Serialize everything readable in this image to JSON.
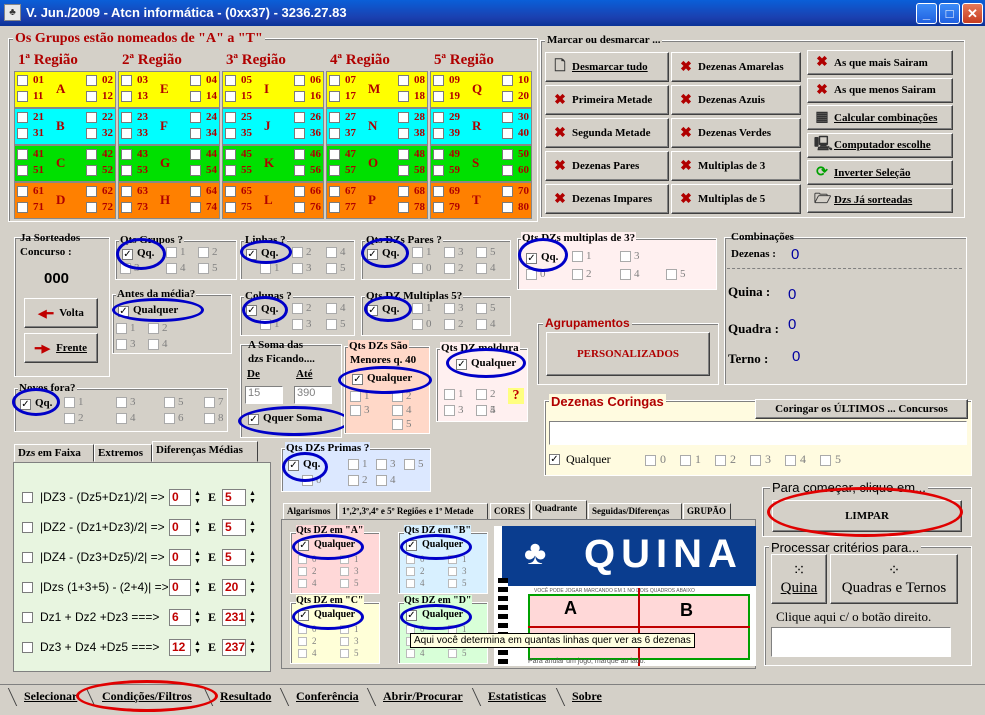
{
  "window": {
    "title": "V. Jun./2009 - Atcn informática - (0xx37) - 3236.27.83",
    "minimize": "_",
    "maximize": "□",
    "close": "✕"
  },
  "groups_title": "Os Grupos estão nomeados de \"A\" a  \"T\"",
  "regions": [
    {
      "title": "1ª Região",
      "rows": [
        {
          "color": "#ffff00",
          "letter": "A",
          "nums": [
            "01",
            "02",
            "11",
            "12"
          ]
        },
        {
          "color": "#00ffff",
          "letter": "B",
          "nums": [
            "21",
            "22",
            "31",
            "32"
          ]
        },
        {
          "color": "#00e000",
          "letter": "C",
          "nums": [
            "41",
            "42",
            "51",
            "52"
          ]
        },
        {
          "color": "#ff8000",
          "letter": "D",
          "nums": [
            "61",
            "62",
            "71",
            "72"
          ]
        }
      ]
    },
    {
      "title": "2ª Região",
      "rows": [
        {
          "color": "#ffff00",
          "letter": "E",
          "nums": [
            "03",
            "04",
            "13",
            "14"
          ]
        },
        {
          "color": "#00ffff",
          "letter": "F",
          "nums": [
            "23",
            "24",
            "33",
            "34"
          ]
        },
        {
          "color": "#00e000",
          "letter": "G",
          "nums": [
            "43",
            "44",
            "53",
            "54"
          ]
        },
        {
          "color": "#ff8000",
          "letter": "H",
          "nums": [
            "63",
            "64",
            "73",
            "74"
          ]
        }
      ]
    },
    {
      "title": "3ª Região",
      "rows": [
        {
          "color": "#ffff00",
          "letter": "I",
          "nums": [
            "05",
            "06",
            "15",
            "16"
          ]
        },
        {
          "color": "#00ffff",
          "letter": "J",
          "nums": [
            "25",
            "26",
            "35",
            "36"
          ]
        },
        {
          "color": "#00e000",
          "letter": "K",
          "nums": [
            "45",
            "46",
            "55",
            "56"
          ]
        },
        {
          "color": "#ff8000",
          "letter": "L",
          "nums": [
            "65",
            "66",
            "75",
            "76"
          ]
        }
      ]
    },
    {
      "title": "4ª Região",
      "rows": [
        {
          "color": "#ffff00",
          "letter": "M",
          "nums": [
            "07",
            "08",
            "17",
            "18"
          ]
        },
        {
          "color": "#00ffff",
          "letter": "N",
          "nums": [
            "27",
            "28",
            "37",
            "38"
          ]
        },
        {
          "color": "#00e000",
          "letter": "O",
          "nums": [
            "47",
            "48",
            "57",
            "58"
          ]
        },
        {
          "color": "#ff8000",
          "letter": "P",
          "nums": [
            "67",
            "68",
            "77",
            "78"
          ]
        }
      ]
    },
    {
      "title": "5ª Região",
      "rows": [
        {
          "color": "#ffff00",
          "letter": "Q",
          "nums": [
            "09",
            "10",
            "19",
            "20"
          ]
        },
        {
          "color": "#00ffff",
          "letter": "R",
          "nums": [
            "29",
            "30",
            "39",
            "40"
          ]
        },
        {
          "color": "#00e000",
          "letter": "S",
          "nums": [
            "49",
            "50",
            "59",
            "60"
          ]
        },
        {
          "color": "#ff8000",
          "letter": "T",
          "nums": [
            "69",
            "70",
            "79",
            "80"
          ]
        }
      ]
    }
  ],
  "marcar": {
    "title": "Marcar  ou desmarcar ...",
    "col1": [
      {
        "icon": "doc-icon",
        "label": "Desmarcar tudo"
      },
      {
        "icon": "x-icon",
        "label": "Primeira Metade"
      },
      {
        "icon": "x-icon",
        "label": "Segunda Metade"
      },
      {
        "icon": "x-icon",
        "label": "Dezenas Pares"
      },
      {
        "icon": "x-icon",
        "label": "Dezenas Impares"
      }
    ],
    "col2": [
      {
        "icon": "x-icon",
        "label": "Dezenas Amarelas"
      },
      {
        "icon": "x-icon",
        "label": "Dezenas Azuis"
      },
      {
        "icon": "x-icon",
        "label": "Dezenas Verdes"
      },
      {
        "icon": "x-icon",
        "label": "Multiplas de 3"
      },
      {
        "icon": "x-icon",
        "label": "Multiplas de 5"
      }
    ],
    "col3": [
      {
        "icon": "x-icon",
        "label": "As que mais Sairam"
      },
      {
        "icon": "x-icon",
        "label": "As que menos Sairam"
      },
      {
        "icon": "calculator-icon",
        "label": "Calcular combinações"
      },
      {
        "icon": "computer-icon",
        "label": "Computador escolhe"
      },
      {
        "icon": "refresh-icon",
        "label": "Inverter Seleção"
      },
      {
        "icon": "folder-icon",
        "label": "Dzs Já sorteadas"
      }
    ]
  },
  "sorteados": {
    "title": "Ja Sorteados",
    "concurso_label": "Concurso :",
    "concurso": "000",
    "volta": "Volta",
    "frente": "Frente"
  },
  "filters": {
    "qtd_grupos": {
      "title": "Qts Grupos ?",
      "sel": "Qq.",
      "opts": [
        "1",
        "2",
        "4",
        "5",
        "3"
      ]
    },
    "linhas": {
      "title": "Linhas ?",
      "sel": "Qq.",
      "opts": [
        "2",
        "4",
        "1",
        "3",
        "5"
      ]
    },
    "pares": {
      "title": "Qts DZs Pares ?",
      "sel": "Qq.",
      "opts": [
        "1",
        "3",
        "5",
        "0",
        "2",
        "4"
      ]
    },
    "mult3": {
      "title": "Qts DZs multiplas de 3?",
      "sel": "Qq.",
      "opts": [
        "1",
        "3",
        "0",
        "2",
        "4",
        "5"
      ]
    },
    "antes_media": {
      "title": "Antes da média?",
      "sel": "Qualquer",
      "opts": [
        "1",
        "2",
        "3",
        "4"
      ]
    },
    "colunas": {
      "title": "Colunas ?",
      "sel": "Qq.",
      "opts": [
        "2",
        "4",
        "1",
        "3",
        "5"
      ]
    },
    "mult5": {
      "title": "Qts DZ Multiplas 5?",
      "sel": "Qq.",
      "opts": [
        "1",
        "3",
        "5",
        "0",
        "2",
        "4"
      ]
    },
    "soma": {
      "title1": "A Soma das",
      "title2": "dzs Ficando....",
      "de_label": "De",
      "ate_label": "Até",
      "de": "15",
      "ate": "390",
      "sel": "Qquer Soma"
    },
    "moldura_menos": {
      "title1": "Qts DZs São",
      "title2": "Menores q. 40",
      "sel": "Qualquer",
      "opts": [
        "1",
        "2",
        "3",
        "4",
        "5"
      ]
    },
    "moldura": {
      "title": "Qts DZ moldura",
      "sel": "Qualquer",
      "opts": [
        "1",
        "2",
        "3",
        "4",
        "5"
      ],
      "help": "?"
    },
    "novos_fora": {
      "title": "Novos fora?",
      "sel": "Qq.",
      "opts": [
        "1",
        "3",
        "5",
        "7",
        "2",
        "4",
        "6",
        "8"
      ]
    },
    "primas": {
      "title": "Qts DZs Primas ?",
      "sel": "Qq.",
      "opts": [
        "1",
        "3",
        "5",
        "0",
        "2",
        "4"
      ]
    }
  },
  "combinacoes": {
    "title": "Combinações",
    "dezenas_label": "Dezenas :",
    "dezenas": "0",
    "quina_label": "Quina :",
    "quina": "0",
    "quadra_label": "Quadra :",
    "quadra": "0",
    "terno_label": "Terno :",
    "terno": "0"
  },
  "agrupamentos": {
    "title": "Agrupamentos",
    "button": "PERSONALIZADOS"
  },
  "coringas": {
    "title": "Dezenas Coringas",
    "button": "Coringar os ÚLTIMOS ... Concursos",
    "sel": "Qualquer",
    "opts": [
      "0",
      "1",
      "2",
      "3",
      "4",
      "5"
    ]
  },
  "left_tabs": [
    "Dzs em Faixa",
    "Extremos",
    "Diferenças Médias"
  ],
  "formulas": [
    {
      "label": "|DZ3 - (Dz5+Dz1)/2| =>",
      "from": "0",
      "to": "5"
    },
    {
      "label": "|DZ2 - (Dz1+Dz3)/2| =>",
      "from": "0",
      "to": "5"
    },
    {
      "label": "|DZ4 - (Dz3+Dz5)/2| =>",
      "from": "0",
      "to": "5"
    },
    {
      "label": "|Dzs (1+3+5) - (2+4)| =>",
      "from": "0",
      "to": "20"
    },
    {
      "label": "Dz1 + Dz2 +Dz3   ===>",
      "from": "6",
      "to": "231"
    },
    {
      "label": "Dz3 + Dz4 +Dz5   ===>",
      "from": "12",
      "to": "237"
    }
  ],
  "e_label": "E",
  "center_tabs": [
    "Algarismos",
    "1º,2º,3º,4º e 5º Regiões e 1º Metade",
    "CORES",
    "Quadrante",
    "Seguidas/Diferenças",
    "GRUPÃO"
  ],
  "quadrantes": [
    {
      "title": "Qts DZ em \"A\"",
      "sel": "Qualquer",
      "opts": [
        "0",
        "1",
        "2",
        "3",
        "4",
        "5"
      ]
    },
    {
      "title": "Qts DZ em \"B\"",
      "sel": "Qualquer",
      "opts": [
        "0",
        "1",
        "2",
        "3",
        "4",
        "5"
      ]
    },
    {
      "title": "Qts DZ em \"C\"",
      "sel": "Qualquer",
      "opts": [
        "0",
        "1",
        "2",
        "3",
        "4",
        "5"
      ]
    },
    {
      "title": "Qts DZ em \"D\"",
      "sel": "Qualquer",
      "opts": [
        "0",
        "1",
        "2",
        "3",
        "4",
        "5"
      ]
    }
  ],
  "quina_banner": "QUINA",
  "quina_small": "VOCÊ PODE JOGAR MARCANDO EM 1 NO DOIS QUADROS ABAIXO",
  "quina_bottom": "Para anular um jogo, marque ao lado.",
  "quad_a": "A",
  "quad_b": "B",
  "tooltip": "Aqui você determina em quantas linhas quer ver as 6 dezenas",
  "comecar": {
    "title": "Para  começar, clique em...",
    "button": "LIMPAR"
  },
  "processar": {
    "title": "Processar critérios para...",
    "quina": "Quina",
    "quadras": "Quadras e Ternos",
    "hint": "Clique aqui c/ o botão direito."
  },
  "bottom_tabs": [
    "Selecionar",
    "Condições/Filtros",
    "Resultado",
    "Conferência",
    "Abrir/Procurar",
    "Estatisticas",
    "Sobre"
  ]
}
